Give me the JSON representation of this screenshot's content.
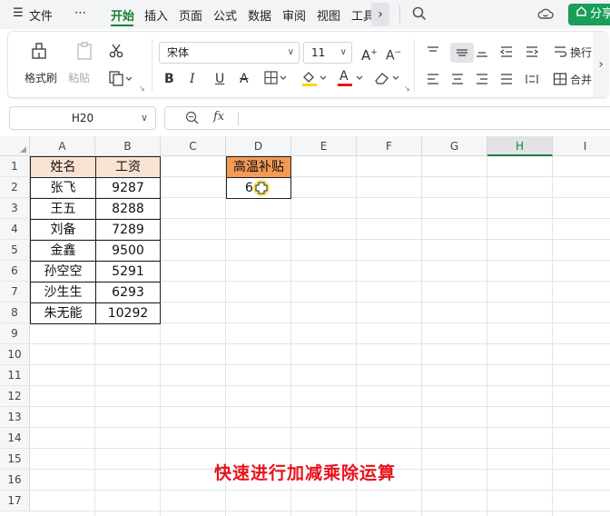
{
  "menubar": {
    "menu_icon": "☰",
    "file_label": "文件",
    "more_icon": "⋯",
    "tabs": [
      {
        "label": "开始",
        "active": true
      },
      {
        "label": "插入"
      },
      {
        "label": "页面"
      },
      {
        "label": "公式"
      },
      {
        "label": "数据"
      },
      {
        "label": "审阅"
      },
      {
        "label": "视图"
      },
      {
        "label": "工具"
      }
    ],
    "scroll_right_icon": "›",
    "search_icon": "search-icon",
    "cloud_icon": "cloud-icon",
    "share_label": "分享"
  },
  "ribbon": {
    "format_painter": "格式刷",
    "paste": "粘贴",
    "font_name": "宋体",
    "font_size": "11",
    "wrap_text": "换行",
    "merge": "合并",
    "bold": "B",
    "italic": "I",
    "underline": "U",
    "strike": "A",
    "font_color_letter": "A",
    "accent_colors": {
      "fill_color": "#ffd400",
      "font_color": "#e8121b"
    }
  },
  "formula_bar": {
    "cell_ref": "H20",
    "fx_label": "fx",
    "formula": ""
  },
  "sheet": {
    "columns": [
      "A",
      "B",
      "C",
      "D",
      "E",
      "F",
      "G",
      "H",
      "I"
    ],
    "selected_column": "H",
    "rows": [
      "1",
      "2",
      "3",
      "4",
      "5",
      "6",
      "7",
      "8",
      "9",
      "10",
      "11",
      "12",
      "13",
      "14",
      "15",
      "16",
      "17"
    ],
    "table": {
      "headers": [
        "姓名",
        "工资"
      ],
      "rows": [
        [
          "张飞",
          "9287"
        ],
        [
          "王五",
          "8288"
        ],
        [
          "刘备",
          "7289"
        ],
        [
          "金鑫",
          "9500"
        ],
        [
          "孙空空",
          "5291"
        ],
        [
          "沙生生",
          "6293"
        ],
        [
          "朱无能",
          "10292"
        ]
      ]
    },
    "bonus_header": "高温补贴",
    "bonus_value": "6",
    "caption": "快速进行加减乘除运算"
  }
}
